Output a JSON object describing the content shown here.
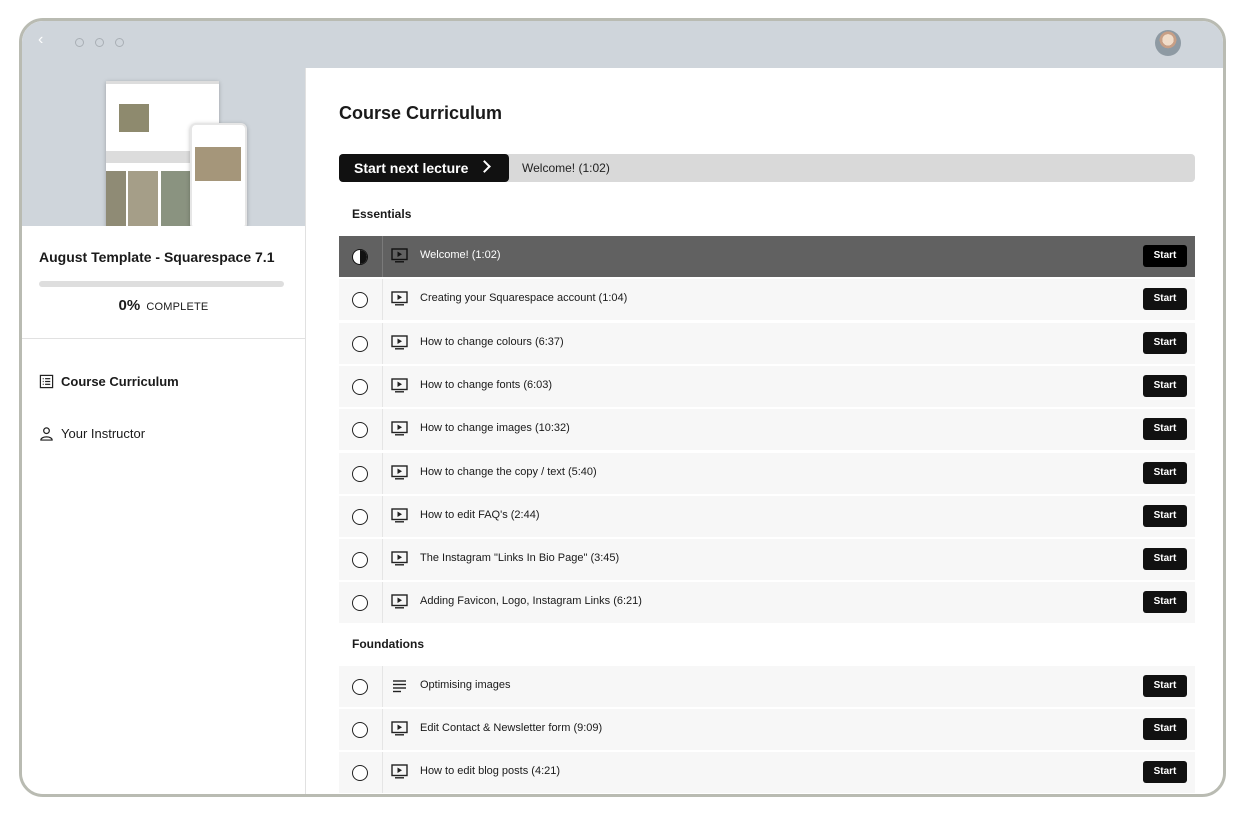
{
  "sidebar": {
    "course_title": "August Template - Squarespace 7.1",
    "progress_percent": 0,
    "progress_label": "0%",
    "complete_label": "COMPLETE",
    "nav": [
      {
        "label": "Course Curriculum",
        "icon": "list-icon",
        "active": true
      },
      {
        "label": "Your Instructor",
        "icon": "user-icon",
        "active": false
      }
    ]
  },
  "main": {
    "title": "Course Curriculum",
    "next_button": "Start next lecture",
    "next_lecture": "Welcome! (1:02)",
    "start_label": "Start",
    "sections": [
      {
        "name": "Essentials",
        "lectures": [
          {
            "title": "Welcome! (1:02)",
            "type": "video-icon",
            "status": "in-progress"
          },
          {
            "title": "Creating your Squarespace account (1:04)",
            "type": "video-icon",
            "status": "not-started"
          },
          {
            "title": "How to change colours (6:37)",
            "type": "video-icon",
            "status": "not-started"
          },
          {
            "title": "How to change fonts (6:03)",
            "type": "video-icon",
            "status": "not-started"
          },
          {
            "title": "How to change images (10:32)",
            "type": "video-icon",
            "status": "not-started"
          },
          {
            "title": "How to change the copy / text (5:40)",
            "type": "video-icon",
            "status": "not-started"
          },
          {
            "title": "How to edit FAQ's (2:44)",
            "type": "video-icon",
            "status": "not-started"
          },
          {
            "title": "The Instagram \"Links In Bio Page\" (3:45)",
            "type": "video-icon",
            "status": "not-started"
          },
          {
            "title": "Adding Favicon, Logo, Instagram Links (6:21)",
            "type": "video-icon",
            "status": "not-started"
          }
        ]
      },
      {
        "name": "Foundations",
        "lectures": [
          {
            "title": "Optimising images",
            "type": "text-icon",
            "status": "not-started"
          },
          {
            "title": "Edit Contact & Newsletter form (9:09)",
            "type": "video-icon",
            "status": "not-started"
          },
          {
            "title": "How to edit blog posts (4:21)",
            "type": "video-icon",
            "status": "not-started"
          }
        ]
      }
    ]
  }
}
